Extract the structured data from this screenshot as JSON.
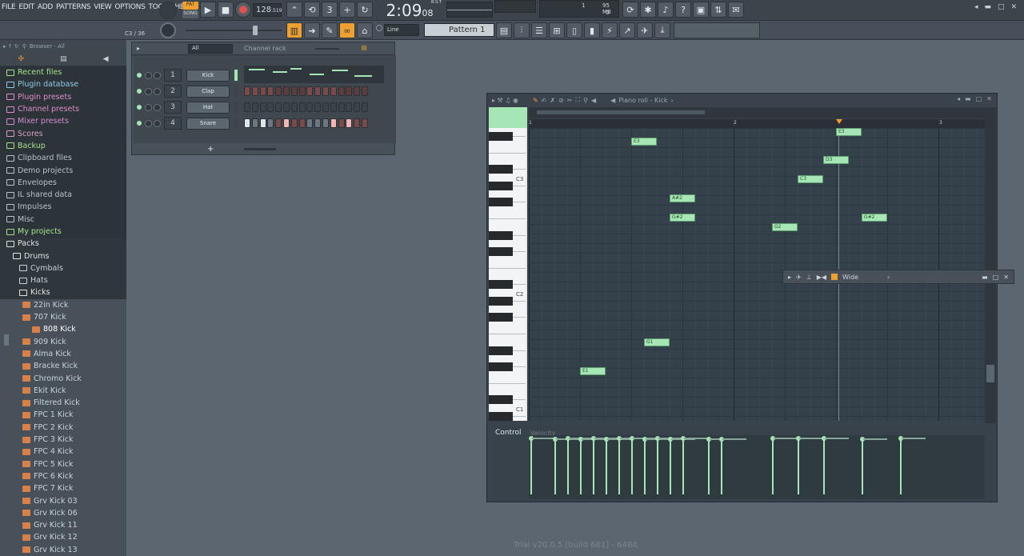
{
  "menu": [
    "FILE",
    "EDIT",
    "ADD",
    "PATTERNS",
    "VIEW",
    "OPTIONS",
    "TOOLS",
    "HELP"
  ],
  "transport": {
    "pat_label": "PAT",
    "song_label": "SONG",
    "tempo": "128",
    "tempo_frac": ".519",
    "time": "2:09",
    "time_frac": "08",
    "time_unit": "B:S:T",
    "cpu": "1",
    "mem": "95 MB",
    "poly": "0"
  },
  "hint": "C3 / 36",
  "snap": "Line",
  "pattern": "Pattern 1",
  "browser": {
    "title": "Browser - All",
    "items": [
      {
        "label": "Recent files",
        "color": "#a8e08c",
        "indent": 0
      },
      {
        "label": "Plugin database",
        "color": "#8fc8e8",
        "indent": 0
      },
      {
        "label": "Plugin presets",
        "color": "#e08cc8",
        "indent": 0
      },
      {
        "label": "Channel presets",
        "color": "#e08cc8",
        "indent": 0
      },
      {
        "label": "Mixer presets",
        "color": "#d48cd0",
        "indent": 0
      },
      {
        "label": "Scores",
        "color": "#d8a0c8",
        "indent": 0
      },
      {
        "label": "Backup",
        "color": "#a8e08c",
        "indent": 0
      },
      {
        "label": "Clipboard files",
        "color": "#b7c2c9",
        "indent": 0
      },
      {
        "label": "Demo projects",
        "color": "#b7c2c9",
        "indent": 0
      },
      {
        "label": "Envelopes",
        "color": "#b7c2c9",
        "indent": 0
      },
      {
        "label": "IL shared data",
        "color": "#b7c2c9",
        "indent": 0
      },
      {
        "label": "Impulses",
        "color": "#b7c2c9",
        "indent": 0
      },
      {
        "label": "Misc",
        "color": "#b7c2c9",
        "indent": 0
      },
      {
        "label": "My projects",
        "color": "#a8e08c",
        "indent": 0
      },
      {
        "label": "Packs",
        "color": "#dfe6ea",
        "indent": 0
      },
      {
        "label": "Drums",
        "color": "#dfe6ea",
        "indent": 1
      },
      {
        "label": "Cymbals",
        "color": "#c9d2d8",
        "indent": 2
      },
      {
        "label": "Hats",
        "color": "#c9d2d8",
        "indent": 2
      },
      {
        "label": "Kicks",
        "color": "#dfe6ea",
        "indent": 2
      },
      {
        "label": "22in Kick",
        "color": "#c9d2d8",
        "indent": 3
      },
      {
        "label": "707 Kick",
        "color": "#c9d2d8",
        "indent": 3
      },
      {
        "label": "808 Kick",
        "color": "#ffffff",
        "indent": 4
      },
      {
        "label": "909 Kick",
        "color": "#c9d2d8",
        "indent": 3
      },
      {
        "label": "Alma Kick",
        "color": "#c9d2d8",
        "indent": 3
      },
      {
        "label": "Bracke Kick",
        "color": "#c9d2d8",
        "indent": 3
      },
      {
        "label": "Chromo Kick",
        "color": "#c9d2d8",
        "indent": 3
      },
      {
        "label": "Ekit Kick",
        "color": "#c9d2d8",
        "indent": 3
      },
      {
        "label": "Filtered Kick",
        "color": "#c9d2d8",
        "indent": 3
      },
      {
        "label": "FPC 1 Kick",
        "color": "#c9d2d8",
        "indent": 3
      },
      {
        "label": "FPC 2 Kick",
        "color": "#c9d2d8",
        "indent": 3
      },
      {
        "label": "FPC 3 Kick",
        "color": "#c9d2d8",
        "indent": 3
      },
      {
        "label": "FPC 4 Kick",
        "color": "#c9d2d8",
        "indent": 3
      },
      {
        "label": "FPC 5 Kick",
        "color": "#c9d2d8",
        "indent": 3
      },
      {
        "label": "FPC 6 Kick",
        "color": "#c9d2d8",
        "indent": 3
      },
      {
        "label": "FPC 7 Kick",
        "color": "#c9d2d8",
        "indent": 3
      },
      {
        "label": "Grv Kick 03",
        "color": "#c9d2d8",
        "indent": 3
      },
      {
        "label": "Grv Kick 06",
        "color": "#c9d2d8",
        "indent": 3
      },
      {
        "label": "Grv Kick 11",
        "color": "#c9d2d8",
        "indent": 3
      },
      {
        "label": "Grv Kick 12",
        "color": "#c9d2d8",
        "indent": 3
      },
      {
        "label": "Grv Kick 13",
        "color": "#c9d2d8",
        "indent": 3
      }
    ]
  },
  "channel_rack": {
    "title": "Channel rack",
    "filter": "All",
    "channels": [
      {
        "num": "1",
        "name": "Kick"
      },
      {
        "num": "2",
        "name": "Clap"
      },
      {
        "num": "3",
        "name": "Hat"
      },
      {
        "num": "4",
        "name": "Snare"
      }
    ],
    "add_label": "+"
  },
  "piano_roll": {
    "title": "Piano roll - Kick",
    "bars": [
      "1",
      "2",
      "3"
    ],
    "key_labels": [
      "C3",
      "C2",
      "C1"
    ],
    "notes": [
      "E3",
      "A#2",
      "G#2",
      "D3",
      "C3",
      "G2",
      "E3",
      "G#2",
      "G1",
      "E1"
    ],
    "control_label": "Control",
    "velocity_label": "Velocity",
    "velocity_levels": [
      0.88,
      0.86,
      0.88,
      0.86,
      0.88,
      0.86,
      0.88,
      0.88,
      0.86,
      0.88,
      0.86,
      0.88,
      0.86,
      0.86,
      0.88,
      0.88,
      0.88,
      0.86,
      0.88,
      0.86,
      0.88,
      0.88
    ]
  },
  "fx_bar": {
    "label": "Wide"
  },
  "footer": "Trial v20.0.5 [build 681] - 64Bit"
}
